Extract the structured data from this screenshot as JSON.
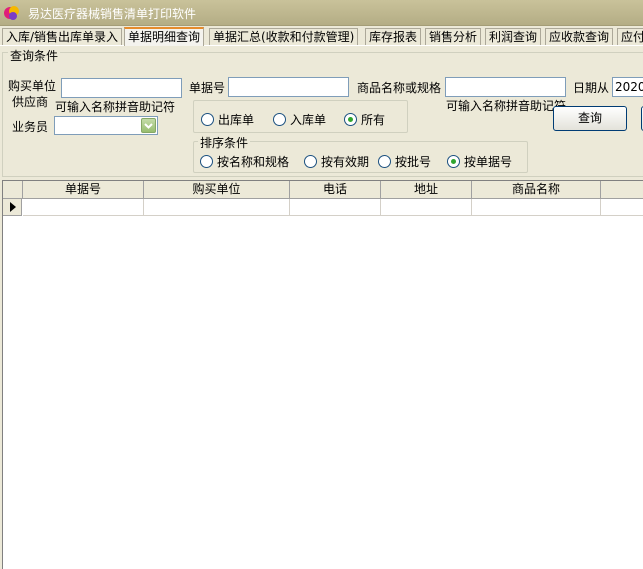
{
  "window": {
    "title": "易达医疗器械销售清单打印软件",
    "icon": "app-logo-icon"
  },
  "tabs": [
    {
      "label": "入库/销售出库单录入",
      "active": false
    },
    {
      "label": "单据明细查询",
      "active": true
    },
    {
      "label": "单据汇总(收款和付款管理)",
      "active": false
    },
    {
      "label": "库存报表",
      "active": false
    },
    {
      "label": "销售分析",
      "active": false
    },
    {
      "label": "利润查询",
      "active": false
    },
    {
      "label": "应收款查询",
      "active": false
    },
    {
      "label": "应付",
      "active": false
    }
  ],
  "query": {
    "legend": "查询条件",
    "buyer_label": "购买单位",
    "supplier_label": "供应商",
    "buyer_hint": "可输入名称拼音助记符",
    "buyer_value": "",
    "doc_no_label": "单据号",
    "doc_no_value": "",
    "product_label": "商品名称或规格",
    "product_value": "",
    "product_hint": "可输入名称拼音助记符",
    "date_from_label": "日期从",
    "date_from_value": "2020-",
    "salesman_label": "业务员",
    "salesman_value": "",
    "doc_type": {
      "options": [
        {
          "label": "出库单",
          "checked": false
        },
        {
          "label": "入库单",
          "checked": false
        },
        {
          "label": "所有",
          "checked": true
        }
      ]
    },
    "sort": {
      "legend": "排序条件",
      "options": [
        {
          "label": "按名称和规格",
          "checked": false
        },
        {
          "label": "按有效期",
          "checked": false
        },
        {
          "label": "按批号",
          "checked": false
        },
        {
          "label": "按单据号",
          "checked": true
        }
      ]
    },
    "query_button": "查询"
  },
  "grid": {
    "columns": [
      "单据号",
      "购买单位",
      "电话",
      "地址",
      "商品名称"
    ]
  }
}
